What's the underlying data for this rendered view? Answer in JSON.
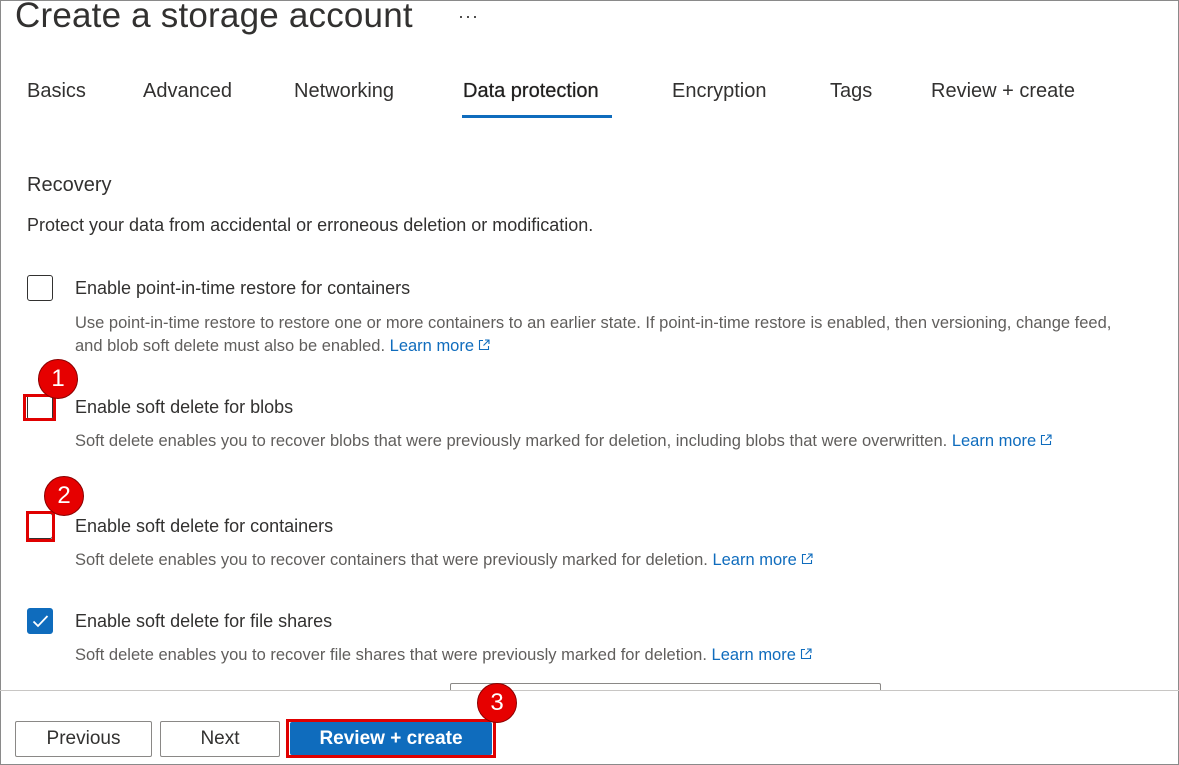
{
  "header": {
    "title": "Create a storage account",
    "more": "···"
  },
  "tabs": [
    {
      "label": "Basics"
    },
    {
      "label": "Advanced"
    },
    {
      "label": "Networking"
    },
    {
      "label": "Data protection",
      "active": true
    },
    {
      "label": "Encryption"
    },
    {
      "label": "Tags"
    },
    {
      "label": "Review + create"
    }
  ],
  "recovery": {
    "heading": "Recovery",
    "description": "Protect your data from accidental or erroneous deletion or modification.",
    "options": [
      {
        "label": "Enable point-in-time restore for containers",
        "help": "Use point-in-time restore to restore one or more containers to an earlier state. If point-in-time restore is enabled, then versioning, change feed, and blob soft delete must also be enabled.",
        "link": "Learn more",
        "checked": false
      },
      {
        "label": "Enable soft delete for blobs",
        "help": "Soft delete enables you to recover blobs that were previously marked for deletion, including blobs that were overwritten.",
        "link": "Learn more",
        "checked": false
      },
      {
        "label": "Enable soft delete for containers",
        "help": "Soft delete enables you to recover containers that were previously marked for deletion.",
        "link": "Learn more",
        "checked": false
      },
      {
        "label": "Enable soft delete for file shares",
        "help": "Soft delete enables you to recover file shares that were previously marked for deletion.",
        "link": "Learn more",
        "checked": true
      }
    ]
  },
  "callouts": {
    "one": "1",
    "two": "2",
    "three": "3"
  },
  "footer": {
    "previous": "Previous",
    "next": "Next",
    "review_create": "Review + create"
  },
  "colors": {
    "accent": "#0f6cbd",
    "callout": "#e60000"
  }
}
